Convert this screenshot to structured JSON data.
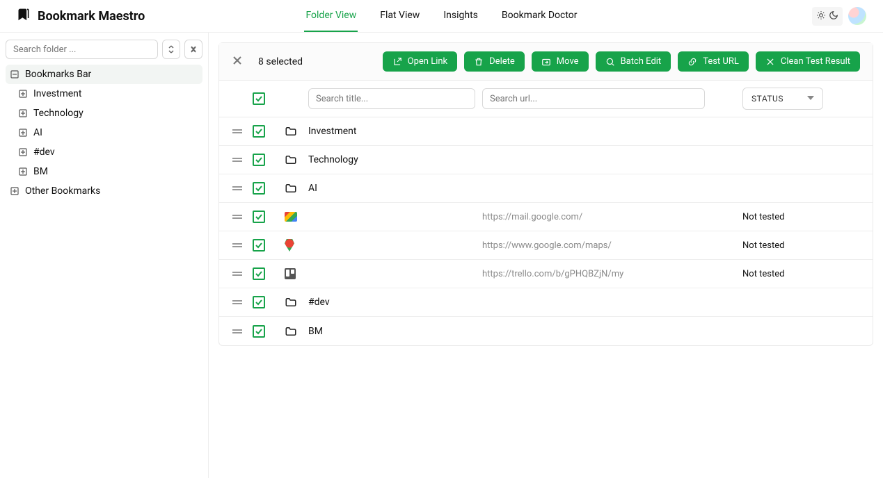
{
  "app": {
    "title": "Bookmark Maestro"
  },
  "nav": {
    "folder_view": "Folder View",
    "flat_view": "Flat View",
    "insights": "Insights",
    "bookmark_doctor": "Bookmark Doctor"
  },
  "sidebar": {
    "search_placeholder": "Search folder ...",
    "items": [
      {
        "label": "Bookmarks Bar"
      },
      {
        "label": "Investment"
      },
      {
        "label": "Technology"
      },
      {
        "label": "AI"
      },
      {
        "label": "#dev"
      },
      {
        "label": "BM"
      },
      {
        "label": "Other Bookmarks"
      }
    ]
  },
  "toolbar": {
    "selected_text": "8 selected",
    "open_link": "Open Link",
    "delete": "Delete",
    "move": "Move",
    "batch_edit": "Batch Edit",
    "test_url": "Test URL",
    "clean_test": "Clean Test Result"
  },
  "filters": {
    "title_placeholder": "Search title...",
    "url_placeholder": "Search url...",
    "status_label": "STATUS"
  },
  "rows": [
    {
      "type": "folder",
      "title": "Investment"
    },
    {
      "type": "folder",
      "title": "Technology"
    },
    {
      "type": "folder",
      "title": "AI"
    },
    {
      "type": "link",
      "favicon": "gmail",
      "title": "",
      "url": "https://mail.google.com/",
      "status": "Not tested"
    },
    {
      "type": "link",
      "favicon": "pin",
      "title": "",
      "url": "https://www.google.com/maps/",
      "status": "Not tested"
    },
    {
      "type": "link",
      "favicon": "trello",
      "title": "",
      "url": "https://trello.com/b/gPHQBZjN/my",
      "status": "Not tested"
    },
    {
      "type": "folder",
      "title": "#dev"
    },
    {
      "type": "folder",
      "title": "BM"
    }
  ]
}
